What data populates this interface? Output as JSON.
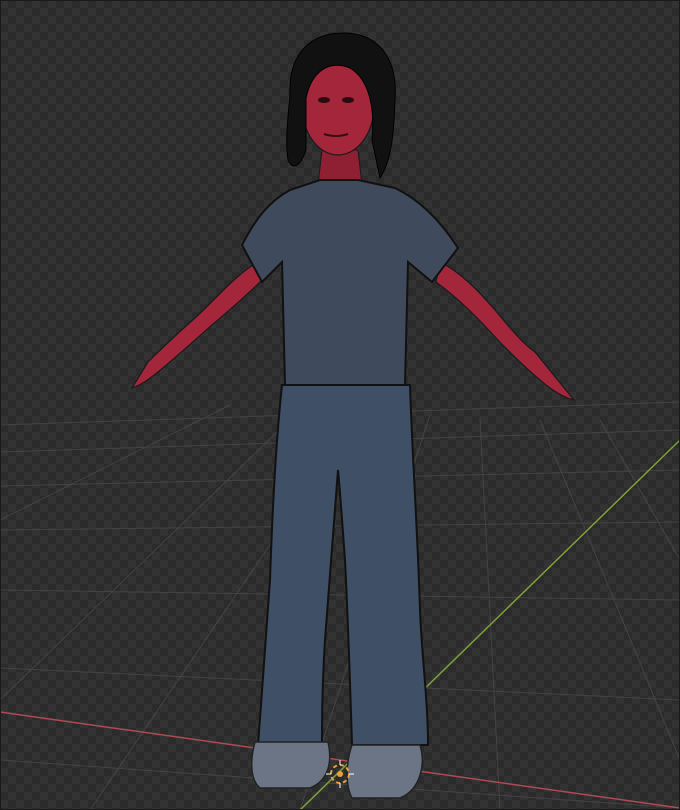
{
  "viewport": {
    "kind": "3D viewport",
    "background": "checkerboard",
    "colors": {
      "checker_light": "#333333",
      "checker_dark": "#2b2b2b",
      "grid_line": "#555555",
      "x_axis": "#b04a55",
      "y_axis": "#7fa13a",
      "skin": "#a3263a",
      "shirt": "#3f4b5c",
      "pants": "#3e4f66",
      "hair": "#111111",
      "shoes": "#6b7585",
      "origin_marker": "#e8a13a"
    }
  },
  "scene": {
    "object": "character-model",
    "pose": "T-pose",
    "icons": {
      "origin": "3d-cursor-icon"
    }
  }
}
